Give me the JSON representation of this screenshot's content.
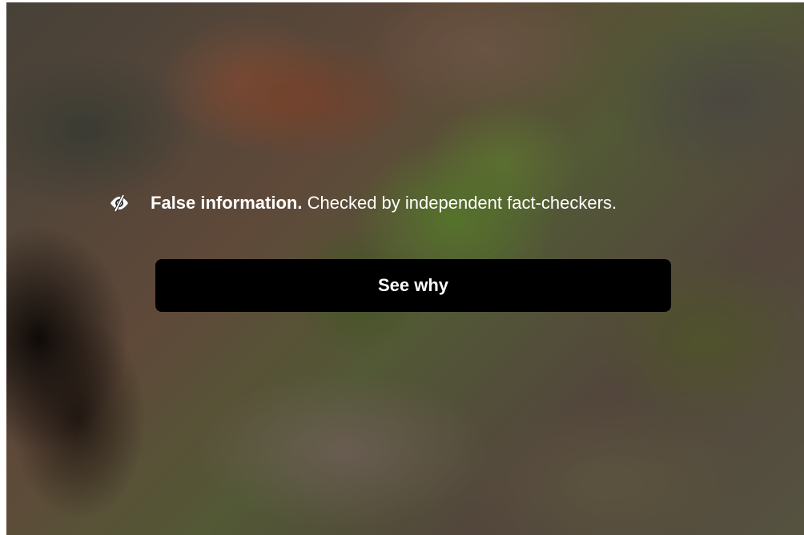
{
  "overlay": {
    "icon": "eye-slash-icon",
    "title": "False information.",
    "description": "Checked by independent fact-checkers.",
    "button_label": "See why"
  },
  "colors": {
    "text": "#ffffff",
    "button_bg": "#000000"
  }
}
